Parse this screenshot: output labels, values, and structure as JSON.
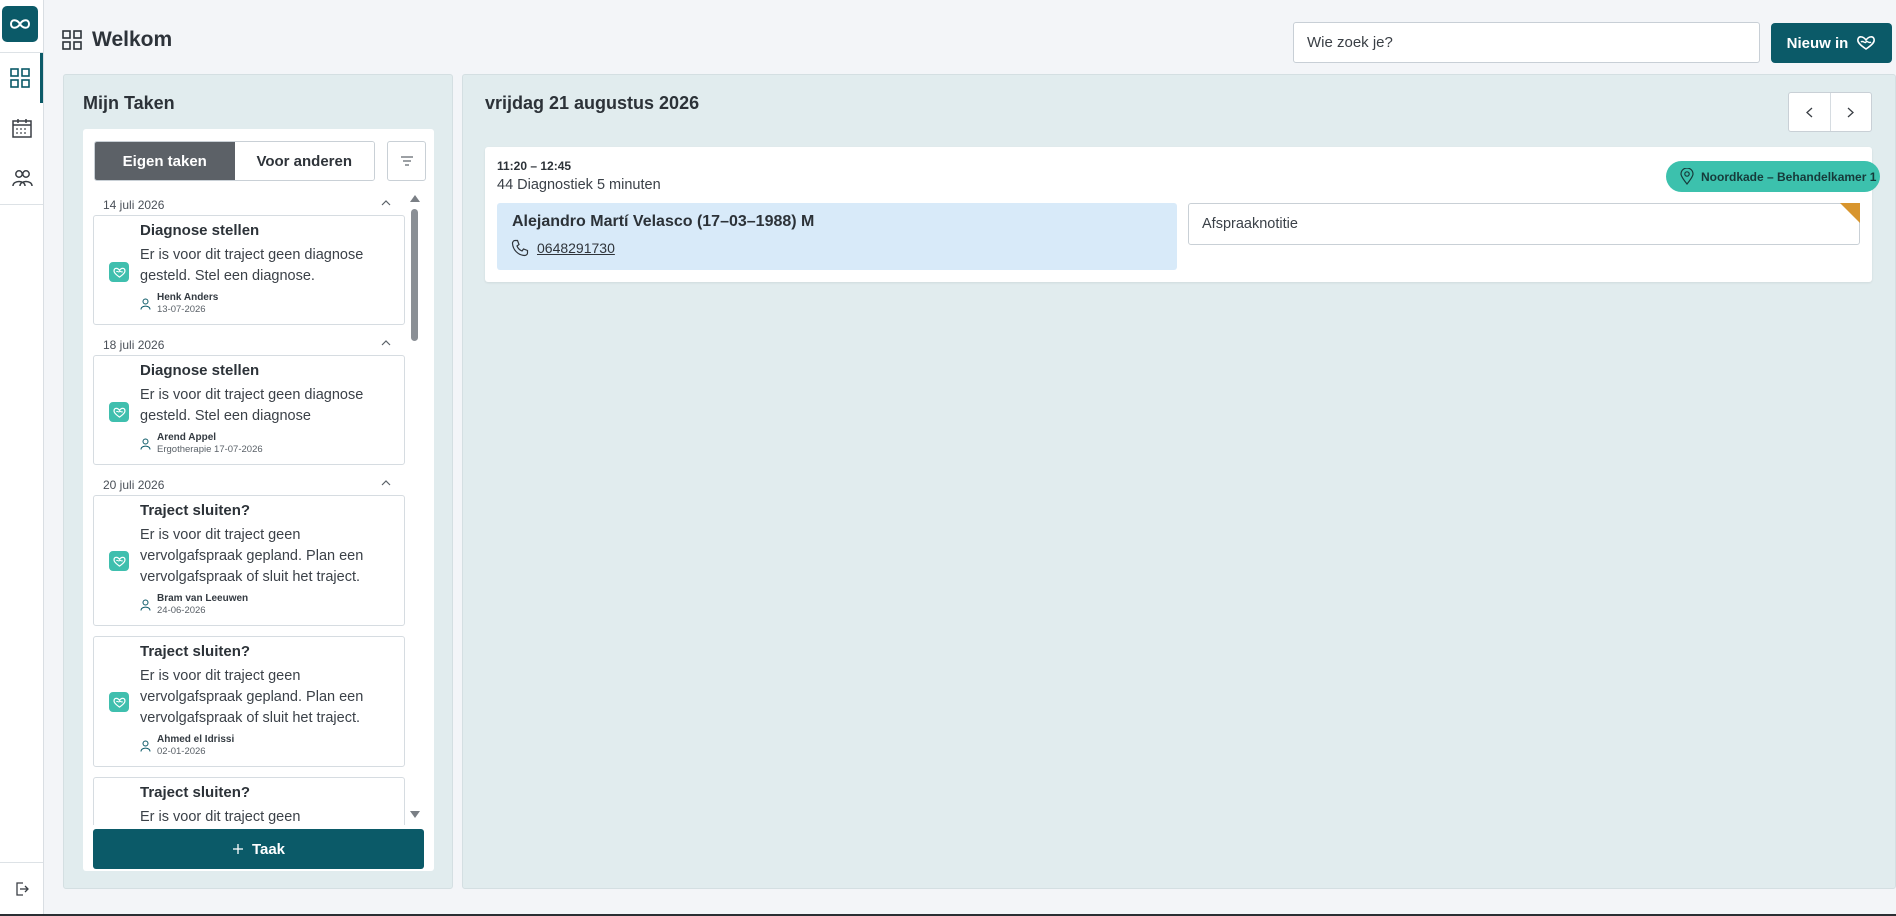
{
  "colors": {
    "brand": "#0b5a68",
    "accent": "#3fbfae",
    "note_flag": "#d8952e",
    "patient_bg": "#d8eaf9"
  },
  "rail": {
    "items": [
      {
        "name": "dashboard",
        "icon": "grid-icon",
        "active": true
      },
      {
        "name": "calendar",
        "icon": "calendar-icon",
        "active": false
      },
      {
        "name": "clients",
        "icon": "people-icon",
        "active": false
      }
    ],
    "logout_icon": "logout-icon"
  },
  "header": {
    "title": "Welkom",
    "search_placeholder": "Wie zoek je?",
    "new_button": "Nieuw in"
  },
  "tasks": {
    "title": "Mijn Taken",
    "tabs": [
      {
        "label": "Eigen taken",
        "active": true
      },
      {
        "label": "Voor anderen",
        "active": false
      }
    ],
    "groups": [
      {
        "date": "14 juli 2026",
        "items": [
          {
            "title": "Diagnose stellen",
            "desc": "Er is voor dit traject geen diagnose gesteld. Stel een diagnose.",
            "person": "Henk Anders",
            "sub": "13-07-2026"
          }
        ]
      },
      {
        "date": "18 juli 2026",
        "items": [
          {
            "title": "Diagnose stellen",
            "desc": "Er is voor dit traject geen diagnose gesteld. Stel een diagnose",
            "person": "Arend Appel",
            "sub": "Ergotherapie 17-07-2026"
          }
        ]
      },
      {
        "date": "20 juli 2026",
        "items": [
          {
            "title": "Traject sluiten?",
            "desc": "Er is voor dit traject geen vervolgafspraak gepland. Plan een vervolgafspraak of sluit het traject.",
            "person": "Bram van Leeuwen",
            "sub": "24-06-2026"
          },
          {
            "title": "Traject sluiten?",
            "desc": "Er is voor dit traject geen vervolgafspraak gepland. Plan een vervolgafspraak of sluit het traject.",
            "person": "Ahmed el Idrissi",
            "sub": "02-01-2026"
          },
          {
            "title": "Traject sluiten?",
            "desc": "Er is voor dit traject geen",
            "person": "",
            "sub": ""
          }
        ]
      }
    ],
    "add_button": "Taak"
  },
  "agenda": {
    "date": "vrijdag 21 augustus 2026",
    "appointment": {
      "time": "11:20 – 12:45",
      "type": "44 Diagnostiek 5 minuten",
      "location": "Noordkade – Behandelkamer 1",
      "patient": "Alejandro Martí Velasco (17–03–1988) M",
      "phone": "0648291730",
      "note_placeholder": "Afspraaknotitie"
    }
  }
}
